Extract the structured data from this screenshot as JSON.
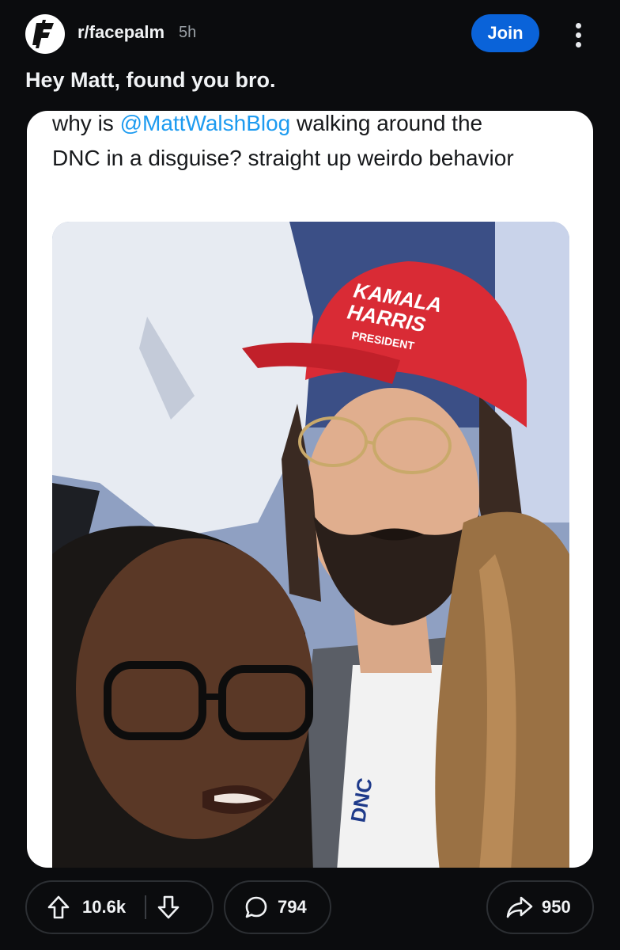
{
  "header": {
    "subreddit": "r/facepalm",
    "time": "5h",
    "join_label": "Join"
  },
  "post": {
    "title": "Hey Matt, found you bro."
  },
  "media": {
    "tweet_line1_prefix": "why is ",
    "tweet_mention": "@MattWalshBlog",
    "tweet_line1_suffix": " walking around the",
    "tweet_rest": "DNC in a disguise? straight up weirdo behavior",
    "hat_line1": "KAMALA",
    "hat_line2": "HARRIS",
    "hat_line3": "PRESIDENT"
  },
  "actions": {
    "upvotes": "10.6k",
    "comments": "794",
    "shares": "950"
  },
  "colors": {
    "background": "#0b0c0e",
    "join_button": "#0a63d9",
    "mention": "#1d9bf0",
    "hat_red": "#d92b35"
  },
  "icons": {
    "logo": "facepalm-logo-icon",
    "more": "more-options-icon",
    "upvote": "upvote-arrow-icon",
    "downvote": "downvote-arrow-icon",
    "comment": "comment-bubble-icon",
    "share": "share-arrow-icon"
  }
}
